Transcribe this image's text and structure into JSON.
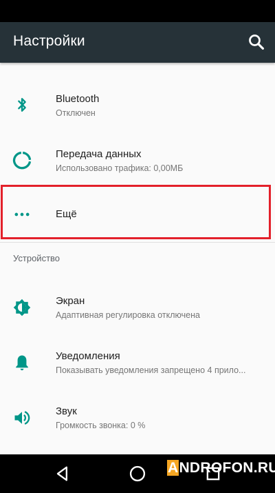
{
  "app_bar": {
    "title": "Настройки",
    "search_icon": "search-icon"
  },
  "items": [
    {
      "title": "Bluetooth",
      "subtitle": "Отключен",
      "icon": "bluetooth-icon"
    },
    {
      "title": "Передача данных",
      "subtitle": "Использовано трафика: 0,00МБ",
      "icon": "data-usage-icon"
    },
    {
      "title": "Ещё",
      "icon": "more-dots-icon"
    }
  ],
  "section": {
    "header": "Устройство"
  },
  "device_items": [
    {
      "title": "Экран",
      "subtitle": "Адаптивная регулировка отключена",
      "icon": "brightness-icon"
    },
    {
      "title": "Уведомления",
      "subtitle": "Показывать уведомления запрещено 4 прило...",
      "icon": "bell-icon"
    },
    {
      "title": "Звук",
      "subtitle": "Громкость звонка: 0 %",
      "icon": "volume-icon"
    }
  ],
  "nav_bar": {
    "back": "back-icon",
    "home": "home-icon",
    "recents": "recents-icon"
  },
  "watermark": {
    "first_letter": "A",
    "rest": "NDROFON.RU"
  },
  "colors": {
    "accent": "#009688",
    "app_bar": "#263238",
    "highlight": "#e3202a"
  }
}
